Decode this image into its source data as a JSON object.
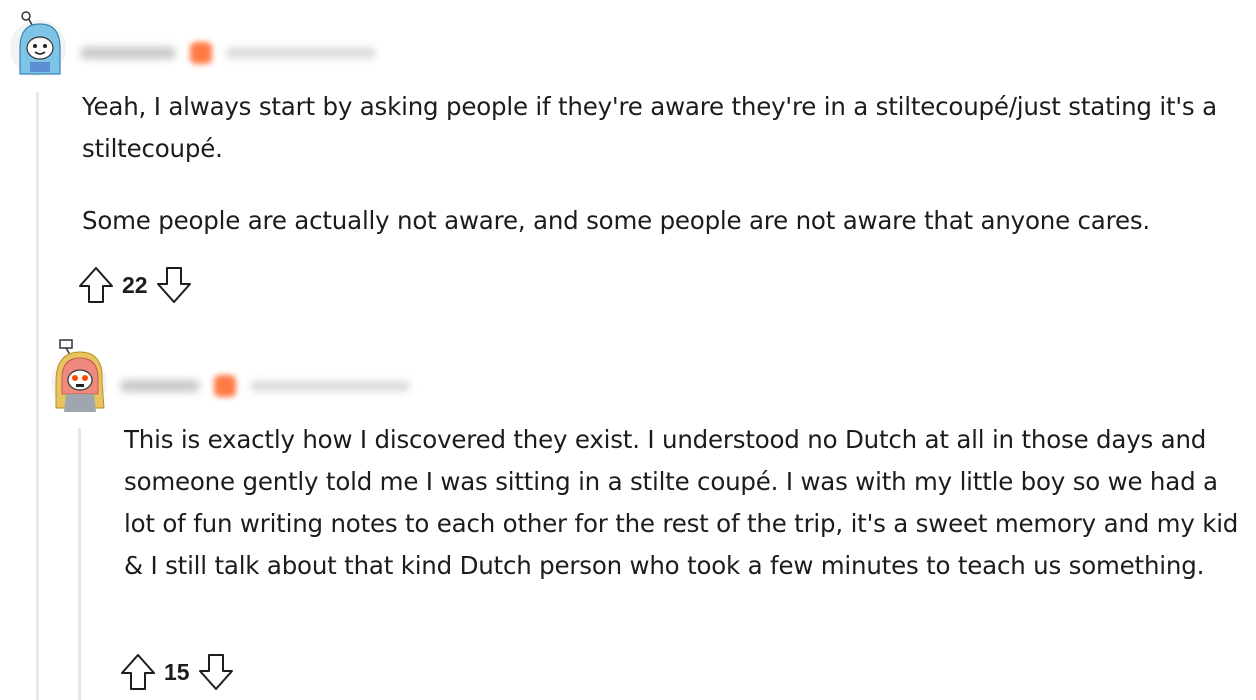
{
  "comments": [
    {
      "avatar_icon": "snoo-avatar-blue-hood-icon",
      "body": [
        "Yeah, I always start by asking people if they're aware they're in a stiltecoupé/just stating it's a stiltecoupé.",
        "Some people are actually not aware, and some people are not aware that anyone cares."
      ],
      "votes": "22"
    },
    {
      "avatar_icon": "snoo-avatar-pink-hood-icon",
      "body": [
        "This is exactly how I discovered they exist. I understood no Dutch at all in those days and someone gently told me I was sitting in a stilte coupé. I was with my little boy so we had a lot of fun writing notes to each other for the rest of the trip, it's a sweet memory and my kid & I still talk about that kind Dutch person who took a few minutes to teach us something."
      ],
      "votes": "15"
    }
  ],
  "colors": {
    "thread_line": "#e5e7e9",
    "text": "#1c1c1c",
    "flair": "#ff7a45"
  }
}
